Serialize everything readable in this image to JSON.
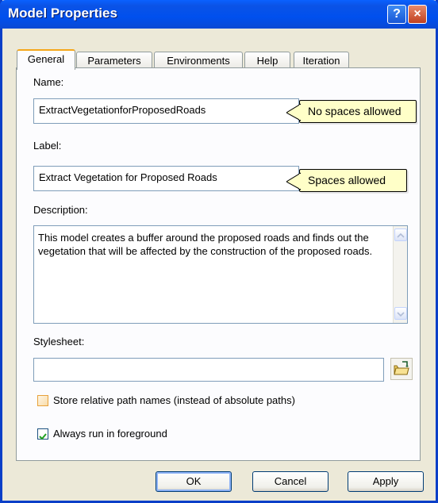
{
  "window": {
    "title": "Model Properties",
    "help_label": "?",
    "close_label": "×"
  },
  "tabs": [
    {
      "label": "General"
    },
    {
      "label": "Parameters"
    },
    {
      "label": "Environments"
    },
    {
      "label": "Help"
    },
    {
      "label": "Iteration"
    }
  ],
  "general": {
    "name_label": "Name:",
    "name_value": "ExtractVegetationforProposedRoads",
    "name_callout": "No spaces allowed",
    "label_label": "Label:",
    "label_value": "Extract Vegetation for Proposed Roads",
    "label_callout": "Spaces allowed",
    "description_label": "Description:",
    "description_value": "This model creates a buffer around the proposed roads and finds out the vegetation that will be affected by the construction of the proposed roads.",
    "stylesheet_label": "Stylesheet:",
    "stylesheet_value": "",
    "relative_paths_label": "Store relative path names (instead of absolute paths)",
    "relative_paths_checked": false,
    "foreground_label": "Always run in foreground",
    "foreground_checked": true
  },
  "buttons": {
    "ok": "OK",
    "cancel": "Cancel",
    "apply": "Apply"
  },
  "colors": {
    "titlebar": "#0050ee",
    "callout_bg": "#ffffc8",
    "dialog_bg": "#ece9d8"
  }
}
